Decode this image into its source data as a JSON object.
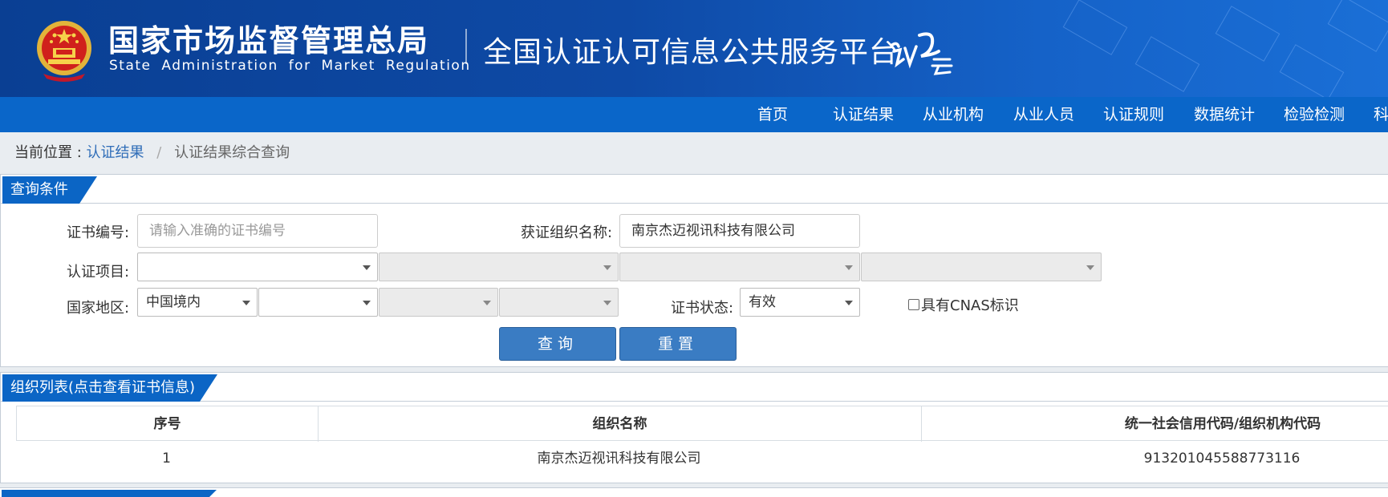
{
  "header": {
    "agency_cn": "国家市场监督管理总局",
    "agency_en": "State Administration for Market Regulation",
    "platform_title": "全国认证认可信息公共服务平台",
    "emblem_icon": "national-emblem-icon",
    "logo_icon": "renzheng-cloud-logo-icon"
  },
  "nav": {
    "items": [
      "首页",
      "认证结果",
      "从业机构",
      "从业人员",
      "认证规则",
      "数据统计",
      "检验检测",
      "科"
    ]
  },
  "breadcrumb": {
    "prefix": "当前位置 :",
    "link": "认证结果",
    "separator": "/",
    "current": "认证结果综合查询"
  },
  "query": {
    "panel_title": "查询条件",
    "cert_no_label": "证书编号:",
    "cert_no_placeholder": "请输入准确的证书编号",
    "org_name_label": "获证组织名称:",
    "org_name_value": "南京杰迈视讯科技有限公司",
    "cert_project_label": "认证项目:",
    "region_label": "国家地区:",
    "region_value": "中国境内",
    "status_label": "证书状态:",
    "status_value": "有效",
    "cnas_label": "具有CNAS标识",
    "cnas_checked": false,
    "search_button": "查询",
    "reset_button": "重置"
  },
  "list": {
    "panel_title": "组织列表(点击查看证书信息)",
    "columns": [
      "序号",
      "组织名称",
      "统一社会信用代码/组织机构代码"
    ],
    "rows": [
      [
        "1",
        "南京杰迈视讯科技有限公司",
        "913201045588773116"
      ]
    ]
  },
  "colors": {
    "header_dark": "#0a3f93",
    "nav_blue": "#0a66c9",
    "button_blue": "#3a7cc3",
    "link_blue": "#2f6db8"
  }
}
